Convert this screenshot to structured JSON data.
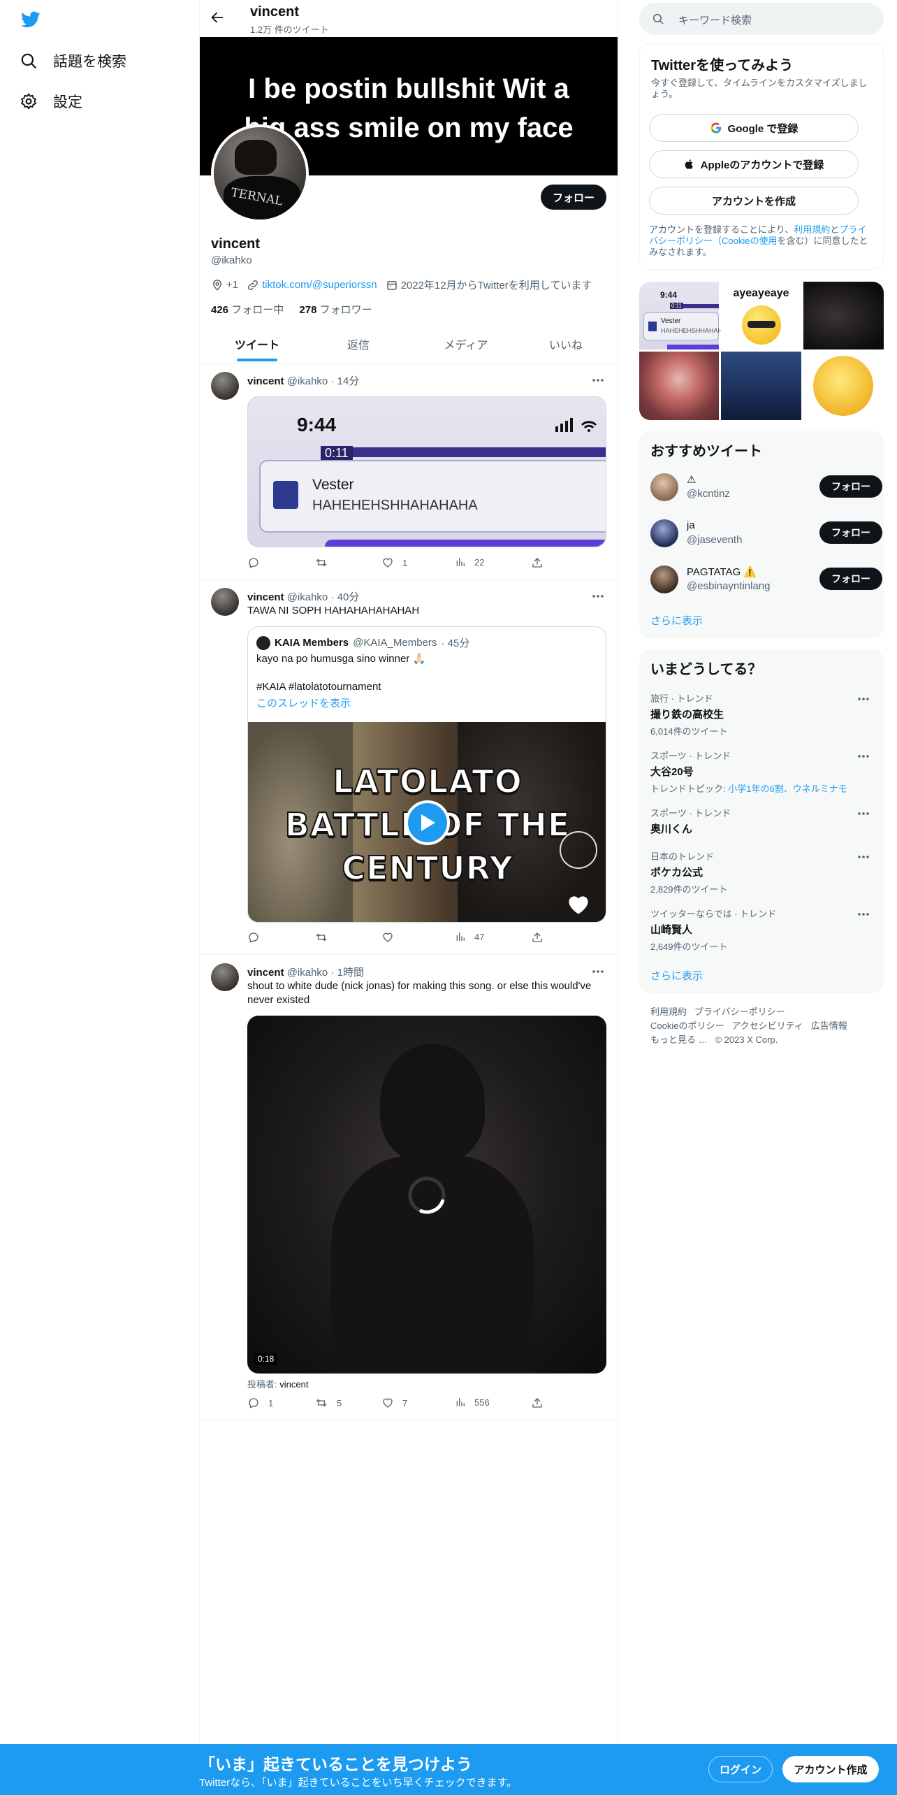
{
  "nav": {
    "explore_label": "話題を検索",
    "settings_label": "設定"
  },
  "header": {
    "name": "vincent",
    "tweet_count": "1.2万 件のツイート"
  },
  "banner": {
    "line1": "I be postin bullshit Wit a",
    "line2": "big ass smile on my face"
  },
  "profile": {
    "avatar_text": "TERNAL",
    "follow_label": "フォロー",
    "display_name": "vincent",
    "handle": "@ikahko",
    "location": "+1",
    "website": "tiktok.com/@superiorssn",
    "joined": "2022年12月からTwitterを利用しています",
    "following_count": "426",
    "following_label": "フォロー中",
    "followers_count": "278",
    "followers_label": "フォロワー"
  },
  "tabs": [
    "ツイート",
    "返信",
    "メディア",
    "いいね"
  ],
  "tweets": [
    {
      "name": "vincent",
      "handle": "@ikahko",
      "time": "· 14分",
      "image": {
        "clock": "9:44",
        "timer": "0:11",
        "card_name": "Vester",
        "card_text": "HAHEHEHSHHAHAHAHA"
      },
      "replies": "",
      "retweets": "",
      "likes": "1",
      "views": "22"
    },
    {
      "name": "vincent",
      "handle": "@ikahko",
      "time": "· 40分",
      "text": "TAWA NI SOPH HAHAHAHAHAHAH",
      "quote": {
        "name": "KAIA Members",
        "handle": "@KAIA_Members",
        "time": "· 45分",
        "text1": "kayo na po humusga sino winner 🙏🏻",
        "text2": "#KAIA #latolatotournament",
        "thread_link": "このスレッドを表示",
        "video_line1": "LATOLATO",
        "video_line2": "BATTLE OF THE",
        "video_line3": "CENTURY"
      },
      "replies": "",
      "retweets": "",
      "likes": "",
      "views": "47"
    },
    {
      "name": "vincent",
      "handle": "@ikahko",
      "time": "· 1時間",
      "text": "shout to white dude (nick jonas) for making this song. or else this would've never existed",
      "video_duration": "0:18",
      "attribution_prefix": "投稿者:",
      "attribution_name": "vincent",
      "replies": "1",
      "retweets": "5",
      "likes": "7",
      "views": "556"
    }
  ],
  "right": {
    "search_placeholder": "キーワード検索",
    "signup": {
      "title": "Twitterを使ってみよう",
      "subtitle": "今すぐ登録して、タイムラインをカスタマイズしましょう。",
      "google_label": "Google で登録",
      "apple_label": "Appleのアカウントで登録",
      "create_label": "アカウントを作成",
      "terms_1": "アカウントを登録することにより、",
      "terms_link1": "利用規約",
      "terms_2": "と",
      "terms_link2": "プライバシーポリシー（Cookieの使用",
      "terms_3": "を含む）に同意したとみなされます。"
    },
    "gallery": {
      "tile1_clock": "9:44",
      "tile1_timer": "0:11",
      "tile1_name": "Vester",
      "tile1_text": "HAHEHEHSHHAHAHAHA",
      "tile2_text": "ayeayeaye"
    },
    "suggestions": {
      "title": "おすすめツイート",
      "items": [
        {
          "name": "⚠",
          "handle": "@kcntinz",
          "follow": "フォロー"
        },
        {
          "name": "ja",
          "handle": "@jaseventh",
          "follow": "フォロー"
        },
        {
          "name": "PAGTATAG ⚠️",
          "handle": "@esbinayntinlang",
          "follow": "フォロー"
        }
      ],
      "show_more": "さらに表示"
    },
    "trends": {
      "title": "いまどうしてる？",
      "items": [
        {
          "meta": "旅行 · トレンド",
          "name": "撮り鉄の高校生",
          "sub": "6,014件のツイート"
        },
        {
          "meta": "スポーツ · トレンド",
          "name": "大谷20号",
          "sub_prefix": "トレンドトピック: ",
          "sub_link": "小学1年の6割、ウネルミナモ"
        },
        {
          "meta": "スポーツ · トレンド",
          "name": "奥川くん"
        },
        {
          "meta": "日本のトレンド",
          "name": "ポケカ公式",
          "sub": "2,829件のツイート"
        },
        {
          "meta": "ツイッターならでは · トレンド",
          "name": "山崎賢人",
          "sub": "2,649件のツイート"
        }
      ],
      "show_more": "さらに表示"
    },
    "footer": {
      "links_row1": [
        "利用規約",
        "プライバシーポリシー"
      ],
      "links_row2": [
        "Cookieのポリシー",
        "アクセシビリティ",
        "広告情報"
      ],
      "more": "もっと見る …",
      "copyright": "© 2023 X Corp."
    }
  },
  "bottom": {
    "title": "「いま」起きていることを見つけよう",
    "subtitle": "Twitterなら、「いま」起きていることをいち早くチェックできます。",
    "login_label": "ログイン",
    "signup_label": "アカウント作成"
  },
  "colors": {
    "accent": "#1d9bf0",
    "text": "#0f1419",
    "muted": "#536471",
    "panel_bg": "#f7f9f9",
    "follow_button": "#0f1419"
  }
}
